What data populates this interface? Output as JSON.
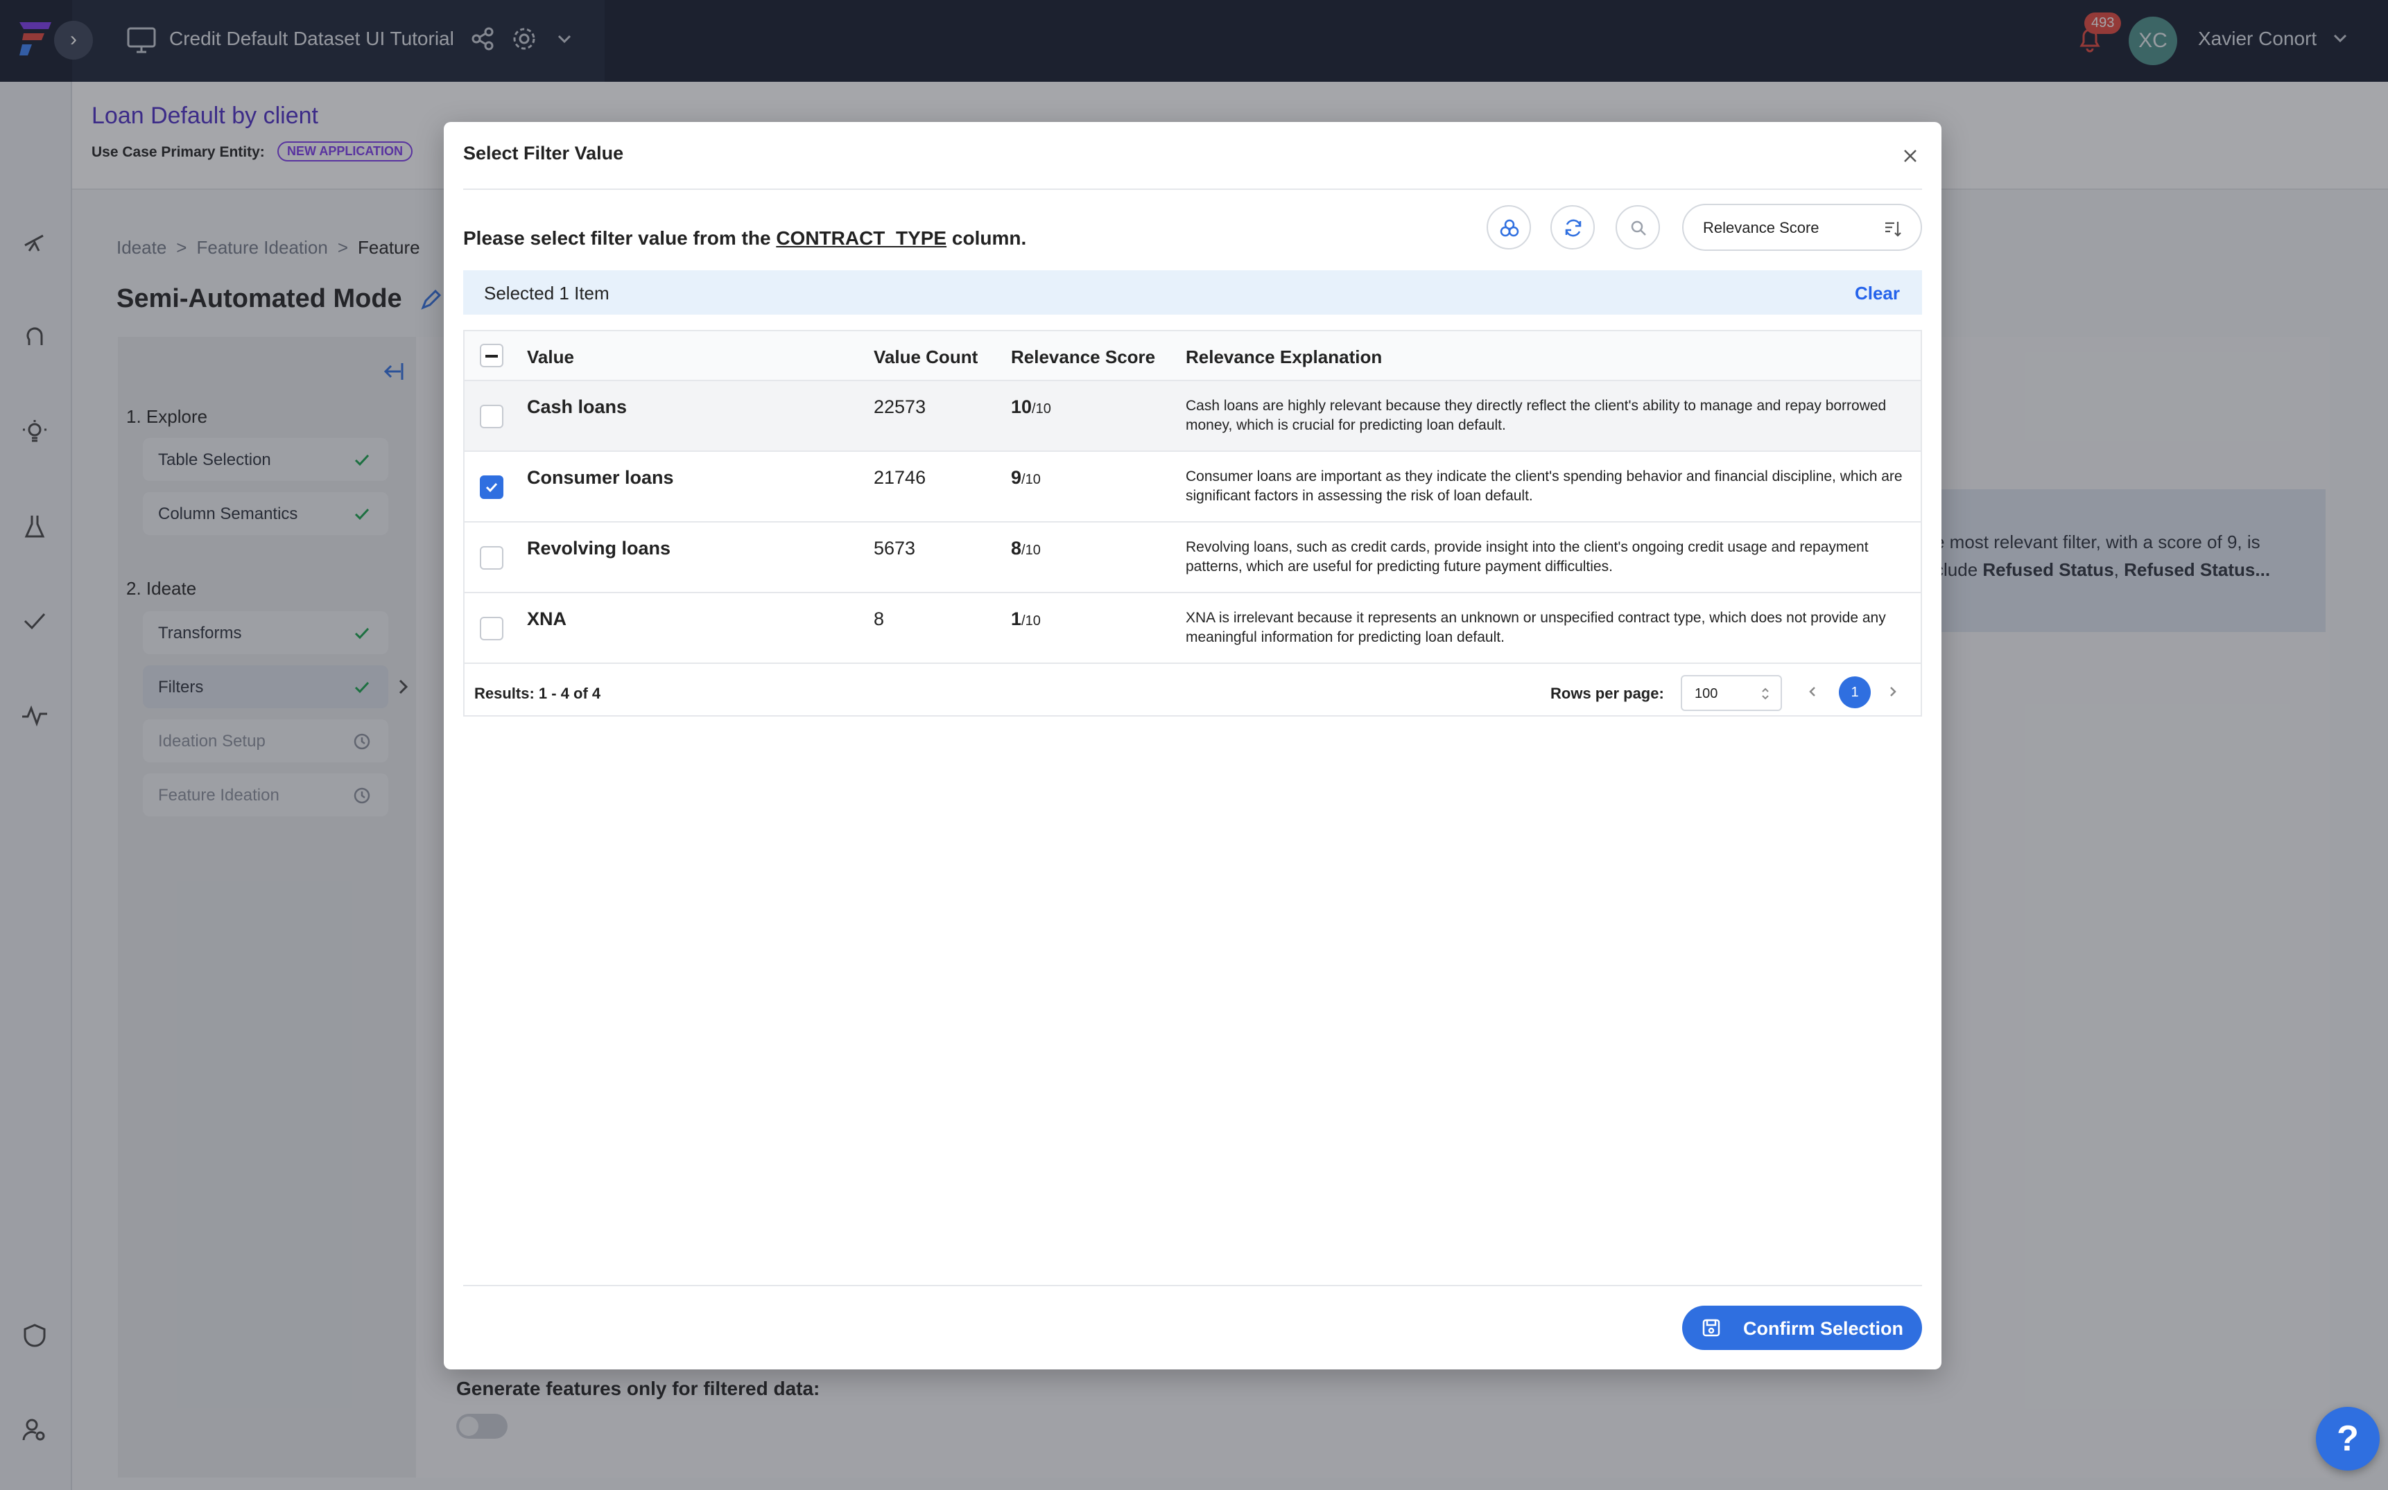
{
  "topbar": {
    "workspace_title": "Credit Default Dataset UI Tutorial",
    "notification_count": "493",
    "user_initials": "XC",
    "user_name": "Xavier Conort"
  },
  "header": {
    "use_case_title": "Loan Default by client",
    "primary_entity_label": "Use Case Primary Entity:",
    "primary_entity_badge": "NEW APPLICATION"
  },
  "page": {
    "breadcrumb": [
      "Ideate",
      "Feature Ideation",
      "Feature"
    ],
    "mode_title": "Semi-Automated Mode",
    "hint_line1": "e most relevant filter, with a score of 9, is",
    "hint_line2_prefix": "clude ",
    "hint_bold1": "Refused Status",
    "hint_sep": ", ",
    "hint_bold2": "Refused Status...",
    "generate_label": "Generate features only for filtered data:"
  },
  "steps": {
    "explore_title": "1. Explore",
    "ideate_title": "2. Ideate",
    "items": [
      {
        "label": "Table Selection",
        "status": "done"
      },
      {
        "label": "Column Semantics",
        "status": "done"
      },
      {
        "label": "Transforms",
        "status": "done"
      },
      {
        "label": "Filters",
        "status": "done"
      },
      {
        "label": "Ideation Setup",
        "status": "pending"
      },
      {
        "label": "Feature Ideation",
        "status": "pending"
      }
    ]
  },
  "modal": {
    "title": "Select Filter Value",
    "instruction_prefix": "Please select filter value from the ",
    "instruction_column": "CONTRACT_TYPE",
    "instruction_suffix": " column.",
    "sort_value": "Relevance Score",
    "selected_text": "Selected 1 Item",
    "clear_label": "Clear",
    "columns": [
      "Value",
      "Value Count",
      "Relevance Score",
      "Relevance Explanation"
    ],
    "rows": [
      {
        "value": "Cash loans",
        "count": "22573",
        "score": "10",
        "denom": "/10",
        "checked": false,
        "explanation": "Cash loans are highly relevant because they directly reflect the client's ability to manage and repay borrowed money, which is crucial for predicting loan default."
      },
      {
        "value": "Consumer loans",
        "count": "21746",
        "score": "9",
        "denom": "/10",
        "checked": true,
        "explanation": "Consumer loans are important as they indicate the client's spending behavior and financial discipline, which are significant factors in assessing the risk of loan default."
      },
      {
        "value": "Revolving loans",
        "count": "5673",
        "score": "8",
        "denom": "/10",
        "checked": false,
        "explanation": "Revolving loans, such as credit cards, provide insight into the client's ongoing credit usage and repayment patterns, which are useful for predicting future payment difficulties."
      },
      {
        "value": "XNA",
        "count": "8",
        "score": "1",
        "denom": "/10",
        "checked": false,
        "explanation": "XNA is irrelevant because it represents an unknown or unspecified contract type, which does not provide any meaningful information for predicting loan default."
      }
    ],
    "results_text": "Results: 1 - 4 of 4",
    "rows_per_page_label": "Rows per page:",
    "rows_per_page_value": "100",
    "current_page": "1",
    "confirm_label": "Confirm Selection"
  },
  "help_label": "?",
  "colors": {
    "accent": "#2f6fe0",
    "topbar": "#131a2b",
    "brand_purple": "#4b2cc4"
  }
}
